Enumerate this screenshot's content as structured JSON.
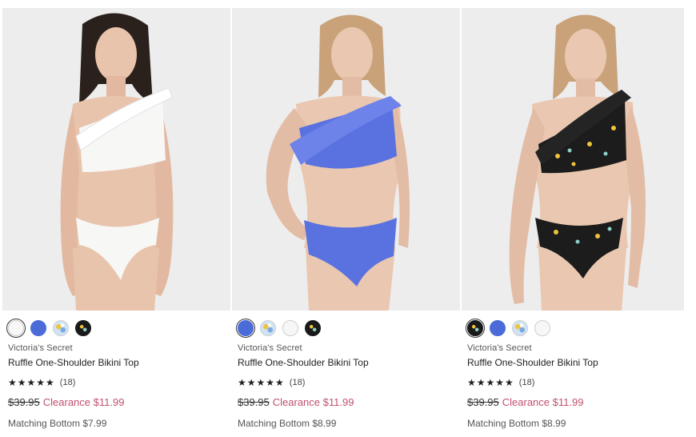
{
  "products": [
    {
      "brand": "Victoria's Secret",
      "name": "Ruffle One-Shoulder Bikini Top",
      "rating_stars": "★★★★★",
      "rating": 5,
      "review_count": "(18)",
      "original_price": "$39.95",
      "clearance_text": "Clearance $11.99",
      "matching_bottom": "Matching Bottom $7.99",
      "suit_color": "#f7f7f5",
      "swatches": [
        "white",
        "blue",
        "print-light",
        "print-black"
      ],
      "selected_swatch": "white"
    },
    {
      "brand": "Victoria's Secret",
      "name": "Ruffle One-Shoulder Bikini Top",
      "rating_stars": "★★★★★",
      "rating": 5,
      "review_count": "(18)",
      "original_price": "$39.95",
      "clearance_text": "Clearance $11.99",
      "matching_bottom": "Matching Bottom $8.99",
      "suit_color": "#5a72e0",
      "swatches": [
        "blue",
        "print-light",
        "white",
        "print-black"
      ],
      "selected_swatch": "blue"
    },
    {
      "brand": "Victoria's Secret",
      "name": "Ruffle One-Shoulder Bikini Top",
      "rating_stars": "★★★★★",
      "rating": 5,
      "review_count": "(18)",
      "original_price": "$39.95",
      "clearance_text": "Clearance $11.99",
      "matching_bottom": "Matching Bottom $8.99",
      "suit_color": "#1c1c1c",
      "swatches": [
        "print-black",
        "blue",
        "print-light",
        "white"
      ],
      "selected_swatch": "print-black"
    }
  ],
  "colors": {
    "clearance": "#c0516e",
    "photo_background": "#ededed",
    "skin": "#e9c4ad"
  }
}
